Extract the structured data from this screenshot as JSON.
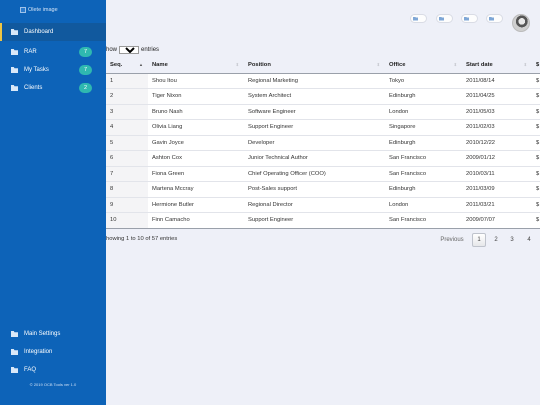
{
  "sidebar": {
    "logo_alt": "Olete image",
    "items": [
      {
        "label": "Dashboard"
      },
      {
        "label": "RAR",
        "badge": "7"
      },
      {
        "label": "My Tasks",
        "badge": "7"
      },
      {
        "label": "Clients",
        "badge": "2"
      }
    ],
    "bottom_items": [
      {
        "label": "Main Settings"
      },
      {
        "label": "Integration"
      },
      {
        "label": "FAQ"
      }
    ],
    "footer": "© 2019 OCB Tools ver 1.0"
  },
  "length_control": {
    "prefix": "how",
    "value": "10",
    "suffix": "entries"
  },
  "table": {
    "columns": [
      "Seq.",
      "Name",
      "Position",
      "Office",
      "Start date",
      "$"
    ],
    "rows": [
      {
        "seq": "1",
        "name": "Shou Itou",
        "position": "Regional Marketing",
        "office": "Tokyo",
        "start_date": "2011/08/14",
        "salary": "$"
      },
      {
        "seq": "2",
        "name": "Tiger Nixon",
        "position": "System Architect",
        "office": "Edinburgh",
        "start_date": "2011/04/25",
        "salary": "$"
      },
      {
        "seq": "3",
        "name": "Bruno Nash",
        "position": "Software Engineer",
        "office": "London",
        "start_date": "2011/05/03",
        "salary": "$"
      },
      {
        "seq": "4",
        "name": "Olivia Liang",
        "position": "Support Engineer",
        "office": "Singapore",
        "start_date": "2011/02/03",
        "salary": "$"
      },
      {
        "seq": "5",
        "name": "Gavin Joyce",
        "position": "Developer",
        "office": "Edinburgh",
        "start_date": "2010/12/22",
        "salary": "$"
      },
      {
        "seq": "6",
        "name": "Ashton Cox",
        "position": "Junior Technical Author",
        "office": "San Francisco",
        "start_date": "2009/01/12",
        "salary": "$"
      },
      {
        "seq": "7",
        "name": "Fiona Green",
        "position": "Chief Operating Officer (COO)",
        "office": "San Francisco",
        "start_date": "2010/03/11",
        "salary": "$"
      },
      {
        "seq": "8",
        "name": "Martena Mccray",
        "position": "Post-Sales support",
        "office": "Edinburgh",
        "start_date": "2011/03/09",
        "salary": "$"
      },
      {
        "seq": "9",
        "name": "Hermione Butler",
        "position": "Regional Director",
        "office": "London",
        "start_date": "2011/03/21",
        "salary": "$"
      },
      {
        "seq": "10",
        "name": "Finn Camacho",
        "position": "Support Engineer",
        "office": "San Francisco",
        "start_date": "2009/07/07",
        "salary": "$"
      }
    ]
  },
  "footer_info": "howing 1 to 10 of 57 entries",
  "pagination": {
    "previous": "Previous",
    "pages": [
      "1",
      "2",
      "3",
      "4"
    ],
    "current": "1"
  },
  "colors": {
    "sidebar": "#0d63b8",
    "badge": "#2fb8b0",
    "active_marker": "#f0c542"
  }
}
